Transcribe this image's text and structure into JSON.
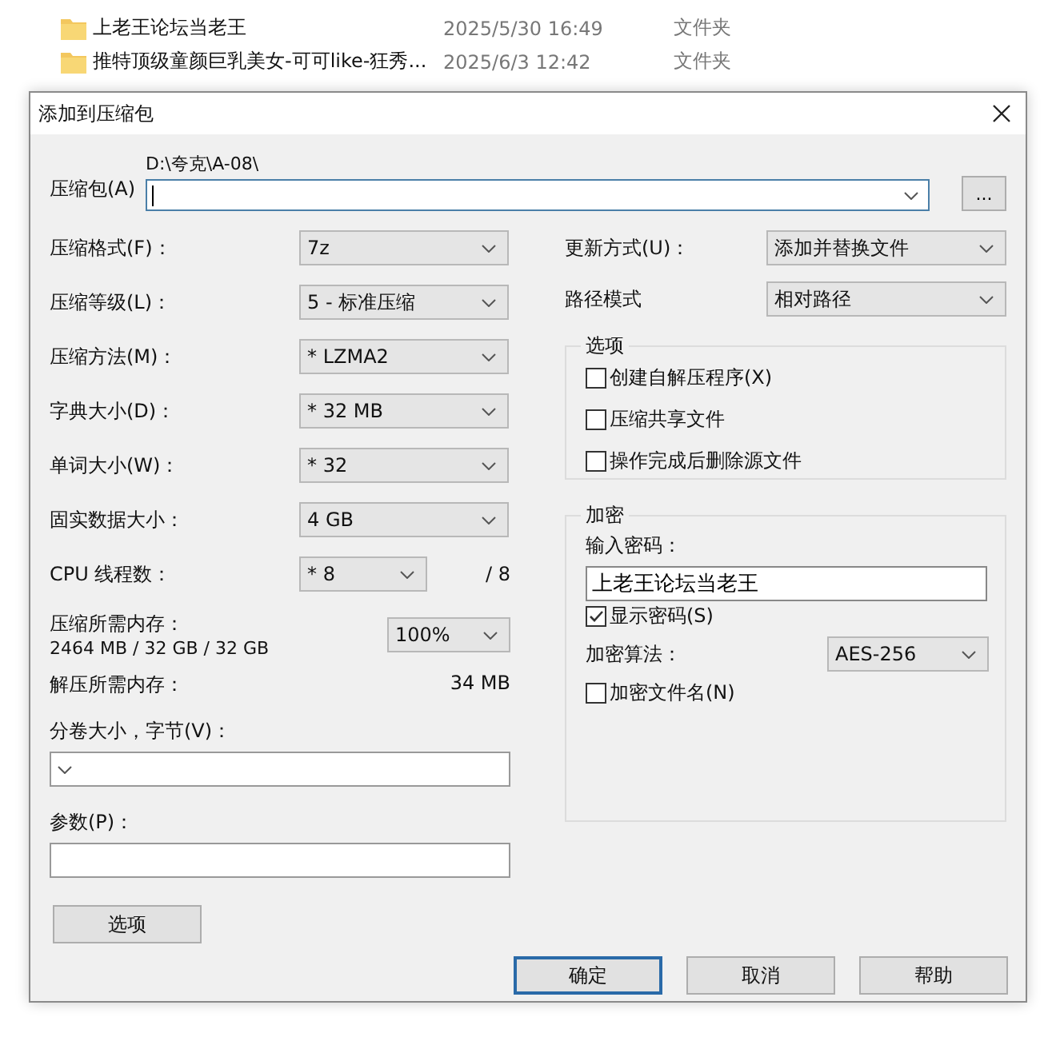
{
  "files": [
    {
      "name": "上老王论坛当老王",
      "date": "2025/5/30 16:49",
      "type": "文件夹"
    },
    {
      "name": "推特顶级童颜巨乳美女-可可like-狂秀...",
      "date": "2025/6/3 12:42",
      "type": "文件夹"
    }
  ],
  "dialog": {
    "title": "添加到压缩包"
  },
  "archive": {
    "label": "压缩包(A)",
    "path": "D:\\夸克\\A-08\\",
    "browse": "..."
  },
  "left_rows": [
    {
      "kind": "combo",
      "label": "压缩格式(F)：",
      "value": "7z"
    },
    {
      "kind": "combo",
      "label": "压缩等级(L)：",
      "value": "5 - 标准压缩"
    },
    {
      "kind": "combo",
      "label": "压缩方法(M)：",
      "value": "* LZMA2"
    },
    {
      "kind": "combo",
      "label": "字典大小(D)：",
      "value": "* 32 MB"
    },
    {
      "kind": "combo",
      "label": "单词大小(W)：",
      "value": "* 32"
    },
    {
      "kind": "combo",
      "label": "固实数据大小：",
      "value": "4 GB"
    },
    {
      "kind": "threads",
      "label": "CPU 线程数：",
      "value": "* 8",
      "suffix": "/ 8"
    },
    {
      "kind": "memory",
      "label": "压缩所需内存：",
      "detail": "2464 MB / 32 GB / 32 GB",
      "value": "100%"
    },
    {
      "kind": "info",
      "label": "解压所需内存：",
      "value": "34 MB"
    }
  ],
  "volume": {
    "label": "分卷大小，字节(V)："
  },
  "params": {
    "label": "参数(P)："
  },
  "options_button": "选项",
  "right_rows": [
    {
      "label": "更新方式(U)：",
      "value": "添加并替换文件"
    },
    {
      "label": "路径模式",
      "value": "相对路径"
    }
  ],
  "options_group": {
    "title": "选项",
    "checkboxes": [
      {
        "label": "创建自解压程序(X)",
        "checked": false
      },
      {
        "label": "压缩共享文件",
        "checked": false
      },
      {
        "label": "操作完成后删除源文件",
        "checked": false
      }
    ]
  },
  "encryption": {
    "title": "加密",
    "password_label": "输入密码：",
    "password": "上老王论坛当老王",
    "show_password": {
      "label": "显示密码(S)",
      "checked": true
    },
    "method_label": "加密算法：",
    "method": "AES-256",
    "encrypt_names": {
      "label": "加密文件名(N)",
      "checked": false
    }
  },
  "buttons": [
    {
      "label": "确定",
      "default": true
    },
    {
      "label": "取消",
      "default": false
    },
    {
      "label": "帮助",
      "default": false
    }
  ]
}
